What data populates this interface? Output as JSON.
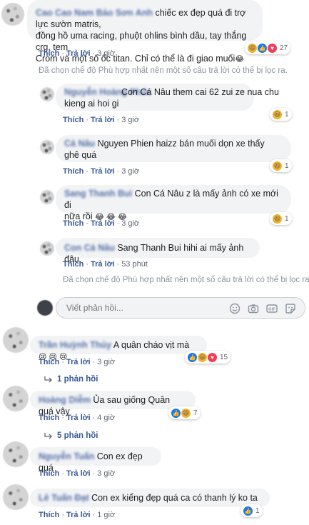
{
  "actions": {
    "like": "Thích",
    "reply": "Trả lời",
    "sep": "·"
  },
  "comments": [
    {
      "author": "Cao Cao Nam Bảo Sơn Anh",
      "lines": [
        "chiếc ex đẹp quá đi trợ lực sườn matris,",
        "đồng hồ uma racing, phuột ohlins bình dầu, tay thắng crg, tem",
        "Crom và một số ốc titan. Chỉ có thể là đi giao muối"
      ],
      "emoji": "😂",
      "time": "3 giờ",
      "reaction_count": "27"
    },
    {
      "author": "Nguyễn Hoàng Phúc",
      "lines": [
        "Con Cá Nâu them cai 62 zui ze nua chu",
        "kieng ai hoi gi"
      ],
      "time": "3 giờ",
      "reaction_count": "1"
    },
    {
      "author": "Cá Nâu",
      "mention": "Nguyen Phien",
      "lines": [
        "haizz bán muối dọn xe thấy",
        "ghê quá"
      ],
      "time": "3 giờ",
      "reaction_count": "1"
    },
    {
      "author": "Sang Thanh Bui",
      "lines": [
        "Con Cá Nâu z là mấy ảnh có xe mới đi",
        "nữa rồi"
      ],
      "emoji": "😂 😂 😂",
      "time": "3 giờ",
      "reaction_count": "1"
    },
    {
      "author": "Con Cá Nâu",
      "lines": [
        "Sang Thanh Bui hihi ai mấy ảnh đâu"
      ],
      "time": "53 phút"
    },
    {
      "author": "Trần Huỳnh Thủy",
      "lines": [
        "A quân cháo vịt mà"
      ],
      "emoji": "😢 😢 😢",
      "time": "3 giờ",
      "reaction_count": "15",
      "replies": "1 phản hồi"
    },
    {
      "author": "Hoàng Diễm",
      "lines": [
        "Ủa sau giống Quân quá vậy"
      ],
      "time": "4 giờ",
      "reaction_count": "7",
      "replies": "5 phản hồi"
    },
    {
      "author": "Nguyễn Tuấn",
      "lines": [
        "Con ex đẹp quá"
      ],
      "time": "3 giờ"
    },
    {
      "author": "Lê Tuấn Đạt",
      "lines": [
        "Con ex kiểng đẹp quá ca có thanh lý ko ta"
      ],
      "time": "1 giờ",
      "reaction_count": "1"
    }
  ],
  "filter_notice": "Đã chọn chế độ Phù hợp nhất nên một số câu trả lời có thể bị lọc ra.",
  "reply_input": {
    "placeholder": "Viết phản hồi..."
  },
  "icons": [
    "reply-arrow-icon",
    "emoji-icon",
    "camera-icon",
    "gif-icon",
    "sticker-icon"
  ],
  "colors": {
    "link": "#385898",
    "bubble": "#f2f3f5",
    "meta": "#606770",
    "notice": "#8d949e"
  }
}
